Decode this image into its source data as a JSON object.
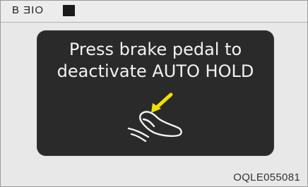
{
  "header": {
    "label": "B ƎIO",
    "square_icon": "black-square-icon"
  },
  "display": {
    "message": "Press brake pedal to\ndeactivate AUTO HOLD",
    "icon": "brake-pedal-foot-icon",
    "arrow_color": "#f0e000",
    "panel_color": "#2a2a2a",
    "text_color": "#f2f2f2"
  },
  "footer": {
    "code": "OQLE055081"
  }
}
